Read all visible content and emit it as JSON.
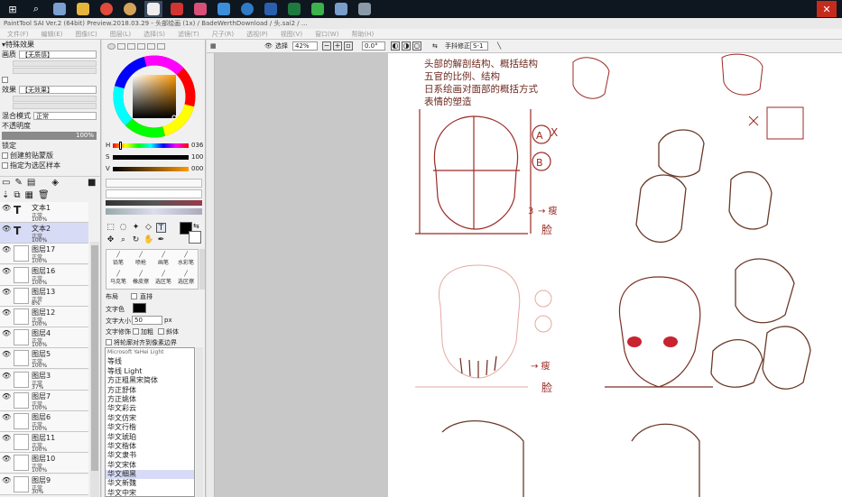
{
  "titlebar": {
    "text": "PaintTool SAI Ver.2 (64bit) Preview.2018.03.29 - 头部绘画 (1x) / BadeWerthDownload / 头.sai2 / ..."
  },
  "menu": [
    "文件(F)",
    "编辑(E)",
    "图像(C)",
    "图层(L)",
    "选择(S)",
    "滤镜(T)",
    "尺子(R)",
    "透视(P)",
    "视图(V)",
    "窗口(W)",
    "帮助(H)"
  ],
  "left": {
    "header": "特殊效果",
    "texture_label": "画质",
    "texture_value": "【无质感】",
    "effect_label": "效果",
    "effect_value": "【无效果】",
    "blend_label": "混合模式",
    "blend_value": "正常",
    "opacity_label": "不透明度",
    "opacity_value": "100%",
    "protect_label": "锁定",
    "clip_label": "创建剪贴蒙版",
    "select_src_label": "指定为选区样本",
    "layers": [
      {
        "name": "文本1",
        "mode": "正常",
        "pct": "100%"
      },
      {
        "name": "文本2",
        "mode": "正常",
        "pct": "100%"
      },
      {
        "name": "图层17",
        "mode": "正常",
        "pct": "100%"
      },
      {
        "name": "图层16",
        "mode": "正常",
        "pct": "100%"
      },
      {
        "name": "图层13",
        "mode": "正常",
        "pct": "8%"
      },
      {
        "name": "图层12",
        "mode": "正常",
        "pct": "100%"
      },
      {
        "name": "图层4",
        "mode": "正常",
        "pct": "100%"
      },
      {
        "name": "图层5",
        "mode": "正常",
        "pct": "100%"
      },
      {
        "name": "图层3",
        "mode": "正常",
        "pct": "37%"
      },
      {
        "name": "图层7",
        "mode": "正常",
        "pct": "100%"
      },
      {
        "name": "图层6",
        "mode": "正常",
        "pct": "100%"
      },
      {
        "name": "图层11",
        "mode": "正常",
        "pct": "100%"
      },
      {
        "name": "图层10",
        "mode": "正常",
        "pct": "100%"
      },
      {
        "name": "图层9",
        "mode": "正常",
        "pct": "30%"
      }
    ]
  },
  "color": {
    "h_label": "H",
    "h_value": "036",
    "s_label": "S",
    "s_value": "100",
    "v_label": "V",
    "v_value": "000",
    "hue_fraction": 0.1,
    "primary_color": "#000000",
    "secondary_color": "#ffffff",
    "accent": "#a0c4ef"
  },
  "brushes": [
    "铅笔",
    "喷枪",
    "画笔",
    "水彩笔",
    "马克笔",
    "橡皮擦",
    "选区笔",
    "选区擦"
  ],
  "text_tool": {
    "layout_label": "布局",
    "vertical_label": "直排",
    "color_label": "文字色",
    "size_label": "文字大小",
    "size_value": "50",
    "size_unit": "px",
    "style_label": "文字修饰",
    "bold_label": "加粗",
    "italic_label": "斜体",
    "align_label": "将轮廓对齐到像素边界"
  },
  "fonts": [
    "Microsoft YaHei Light",
    "等线",
    "等线 Light",
    "方正粗黑宋简体",
    "方正舒体",
    "方正姚体",
    "华文彩云",
    "华文仿宋",
    "华文行楷",
    "华文琥珀",
    "华文楷体",
    "华文隶书",
    "华文宋体",
    "华文细黑",
    "华文新魏",
    "华文中宋"
  ],
  "fonts_highlight": 13,
  "toolbar": {
    "select_label": "选择",
    "zoom_value": "42%",
    "rotate_value": "0.0°",
    "stabilizer_label": "手抖修正",
    "stabilizer_value": "S-1"
  },
  "canvas_notes": [
    "头部的解剖结构、概括结构",
    "五官的比例、结构",
    "日系绘画对面部的概括方式",
    "表情的塑造"
  ],
  "canvas_labels": {
    "a": "A",
    "b": "B",
    "x": "X",
    "three": "3",
    "arrow_text": "→ 瘦",
    "face_text": "脸",
    "arrow_text2": "→ 瘦",
    "face_text2": "脸"
  }
}
